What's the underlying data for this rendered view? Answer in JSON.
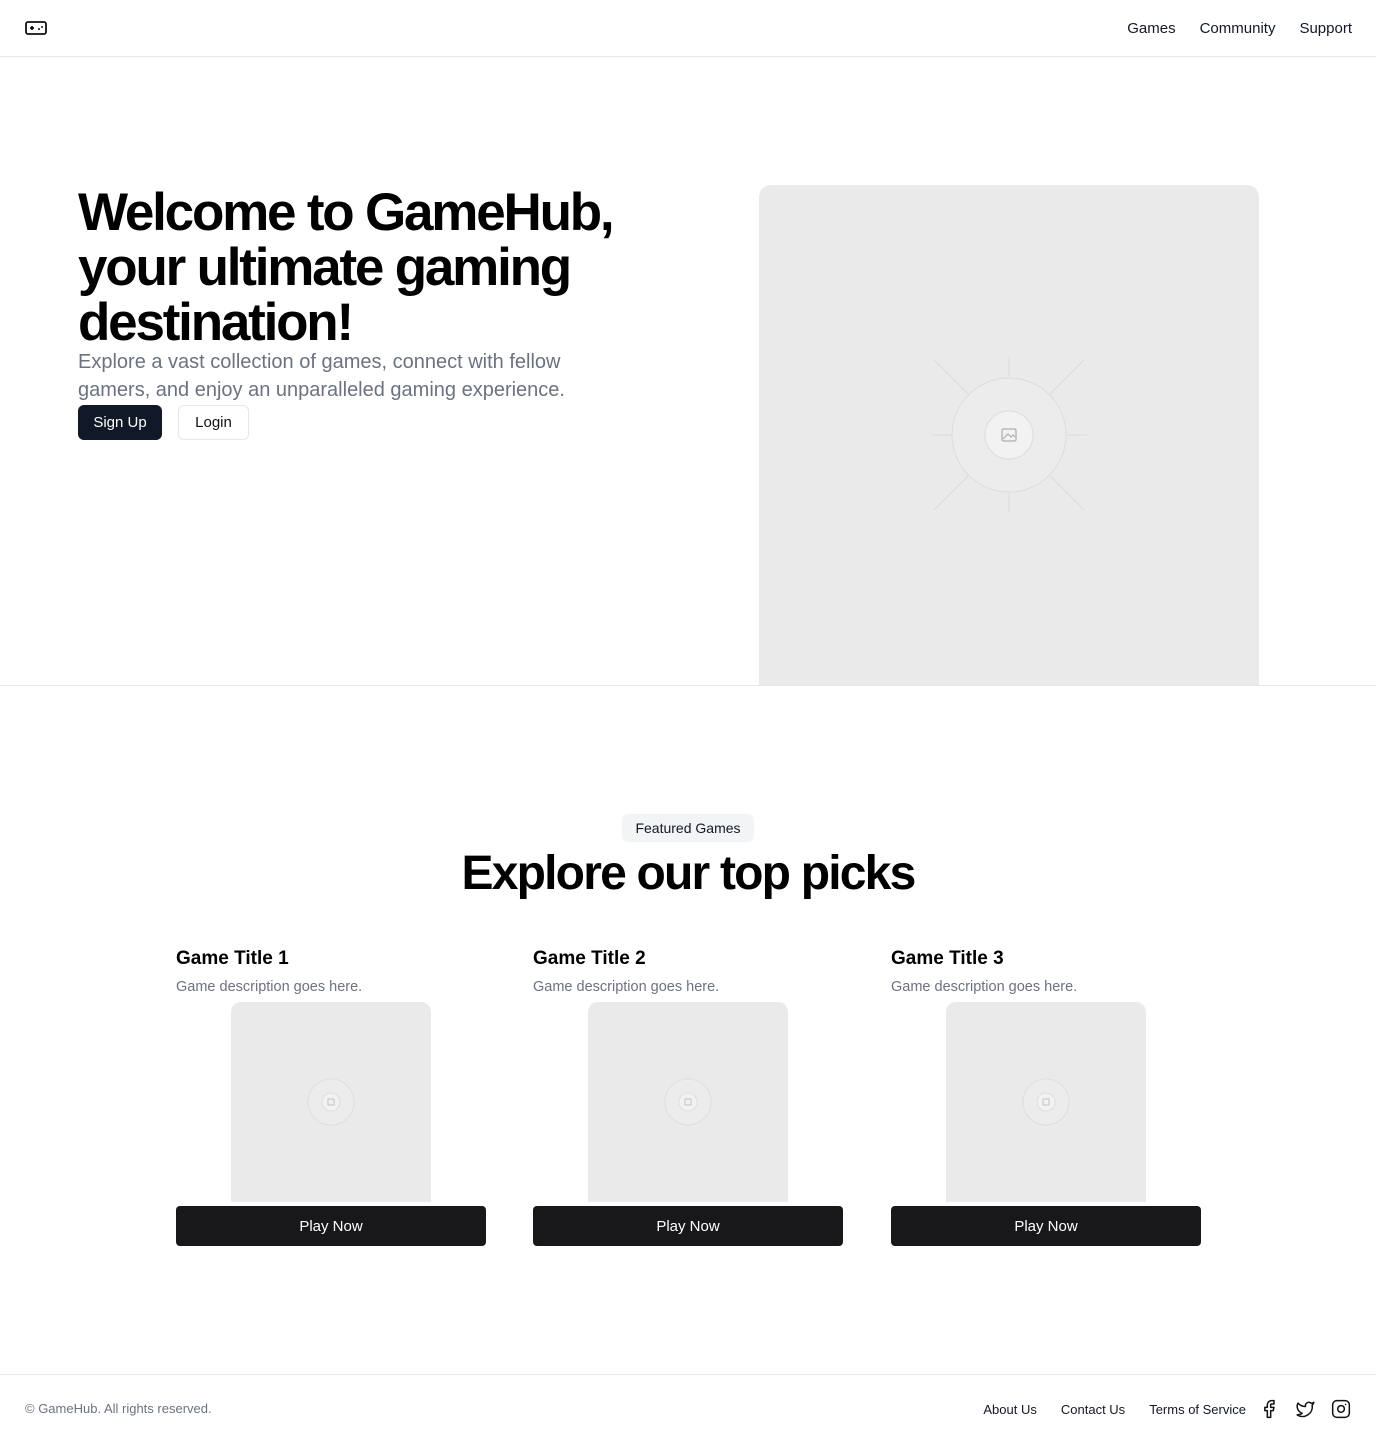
{
  "header": {
    "logo_icon": "gamepad-icon",
    "nav": [
      "Games",
      "Community",
      "Support"
    ]
  },
  "hero": {
    "title": "Welcome to GameHub, your ultimate gaming destination!",
    "subtitle": "Explore a vast collection of games, connect with fellow gamers, and enjoy an unparalleled gaming experience.",
    "signup_label": "Sign Up",
    "login_label": "Login",
    "image_icon": "image-placeholder-icon"
  },
  "featured": {
    "badge": "Featured Games",
    "title": "Explore our top picks",
    "cards": [
      {
        "title": "Game Title 1",
        "description": "Game description goes here.",
        "button": "Play Now"
      },
      {
        "title": "Game Title 2",
        "description": "Game description goes here.",
        "button": "Play Now"
      },
      {
        "title": "Game Title 3",
        "description": "Game description goes here.",
        "button": "Play Now"
      }
    ]
  },
  "footer": {
    "copyright": "© GameHub. All rights reserved.",
    "links": [
      "About Us",
      "Contact Us",
      "Terms of Service"
    ],
    "social_icons": [
      "facebook-icon",
      "twitter-icon",
      "instagram-icon"
    ]
  },
  "colors": {
    "primary_button": "#111827",
    "play_button": "#18181b",
    "muted_text": "#6b7280",
    "placeholder_bg": "#eaeaea"
  }
}
